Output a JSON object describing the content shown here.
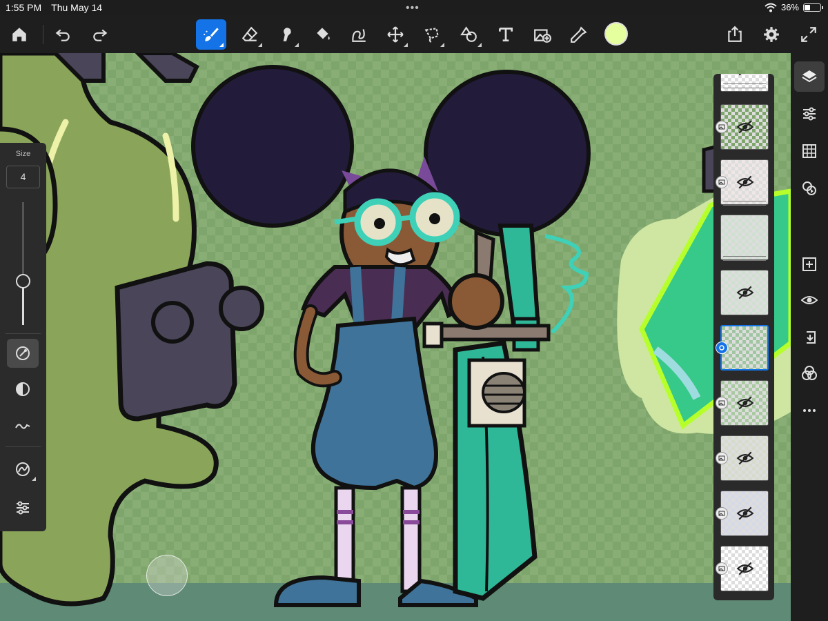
{
  "status": {
    "time": "1:55 PM",
    "date": "Thu May 14",
    "battery": "36%",
    "battery_level": 0.36,
    "multitask_dots": "•••"
  },
  "toolbar": {
    "left": [
      "home-icon",
      "undo-icon",
      "redo-icon"
    ],
    "tools": [
      "brush-icon",
      "eraser-icon",
      "smudge-icon",
      "fill-icon",
      "liquify-icon",
      "transform-icon",
      "lasso-icon",
      "shapes-icon",
      "text-icon",
      "image-add-icon",
      "eyedropper-icon"
    ],
    "active_tool": "brush-icon",
    "current_color": "#e6ff9e",
    "right": [
      "share-icon",
      "gear-icon",
      "fullscreen-icon"
    ]
  },
  "tool_panel": {
    "size_label": "Size",
    "size_value": "4",
    "size_level": 0.36,
    "buttons": [
      "brush-settings-icon",
      "opacity-icon",
      "smoothing-icon",
      "pressure-icon",
      "tool-options-icon"
    ]
  },
  "right_sidebar": [
    "layers-icon",
    "layer-properties-icon",
    "grid-icon",
    "blend-icon",
    "add-layer-icon",
    "visibility-icon",
    "merge-down-icon",
    "mask-icon",
    "more-icon"
  ],
  "layers": [
    {
      "hidden": true,
      "selected": false,
      "type": "group-top"
    },
    {
      "hidden": true,
      "selected": false,
      "type": "image"
    },
    {
      "hidden": true,
      "selected": false,
      "type": "image"
    },
    {
      "hidden": false,
      "selected": false,
      "type": "pixel"
    },
    {
      "hidden": true,
      "selected": false,
      "type": "pixel"
    },
    {
      "hidden": false,
      "selected": true,
      "type": "pixel"
    },
    {
      "hidden": true,
      "selected": false,
      "type": "image"
    },
    {
      "hidden": true,
      "selected": false,
      "type": "image"
    },
    {
      "hidden": true,
      "selected": false,
      "type": "image"
    },
    {
      "hidden": true,
      "selected": false,
      "type": "image"
    }
  ],
  "colors": {
    "accent": "#1473e6",
    "canvas_bg": "#7ea56b",
    "hair": "#221c3a",
    "skin": "#8a5a36",
    "overalls": "#3f7399",
    "shirt": "#4a2d52",
    "glasses": "#3fd0b8",
    "guitar": "#2fb897",
    "robot": "#8aa55a",
    "speaker": "#4a4558"
  }
}
